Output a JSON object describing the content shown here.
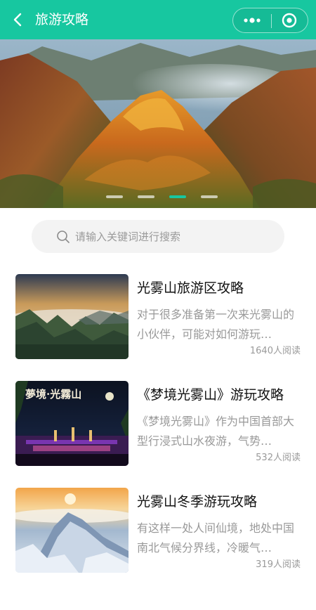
{
  "nav": {
    "title": "旅游攻略",
    "bg_color": "#17c7a0",
    "back_icon": "back-chevron-icon",
    "more_icon": "more-dots-icon",
    "close_icon": "target-circle-icon"
  },
  "banner": {
    "slide_count": 4,
    "active_index": 2
  },
  "search": {
    "placeholder": "请输入关键词进行搜索",
    "value": ""
  },
  "articles": [
    {
      "title": "光雾山旅游区攻略",
      "desc": "对于很多准备第一次来光雾山的小伙伴，可能对如何游玩…",
      "reads": "1640",
      "reads_suffix": "人阅读"
    },
    {
      "title": "《梦境光雾山》游玩攻略",
      "desc": "《梦境光雾山》作为中国首部大型行浸式山水夜游，气势…",
      "reads": "532",
      "reads_suffix": "人阅读",
      "poster_title": "夢境·光霧山"
    },
    {
      "title": "光雾山冬季游玩攻略",
      "desc": "有这样一处人间仙境，地处中国南北气候分界线，冷暖气…",
      "reads": "319",
      "reads_suffix": "人阅读"
    }
  ],
  "colors": {
    "accent": "#17c7a0",
    "muted_text": "#999999",
    "title_text": "#111111",
    "search_bg": "#f3f3f3"
  }
}
